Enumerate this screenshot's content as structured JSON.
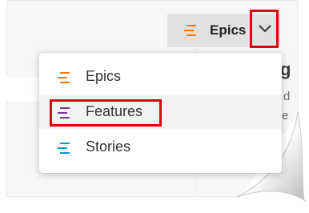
{
  "selector": {
    "current_label": "Epics",
    "icon": "backlog-lines-icon",
    "icon_color": "#ff7b00"
  },
  "menu": {
    "items": [
      {
        "label": "Epics",
        "icon": "backlog-lines-icon",
        "color": "#ff7b00"
      },
      {
        "label": "Features",
        "icon": "backlog-lines-icon",
        "color": "#773b93"
      },
      {
        "label": "Stories",
        "icon": "backlog-lines-icon",
        "color": "#009ccc"
      }
    ],
    "highlighted_index": 1
  },
  "annotation_color": "#e3000f"
}
